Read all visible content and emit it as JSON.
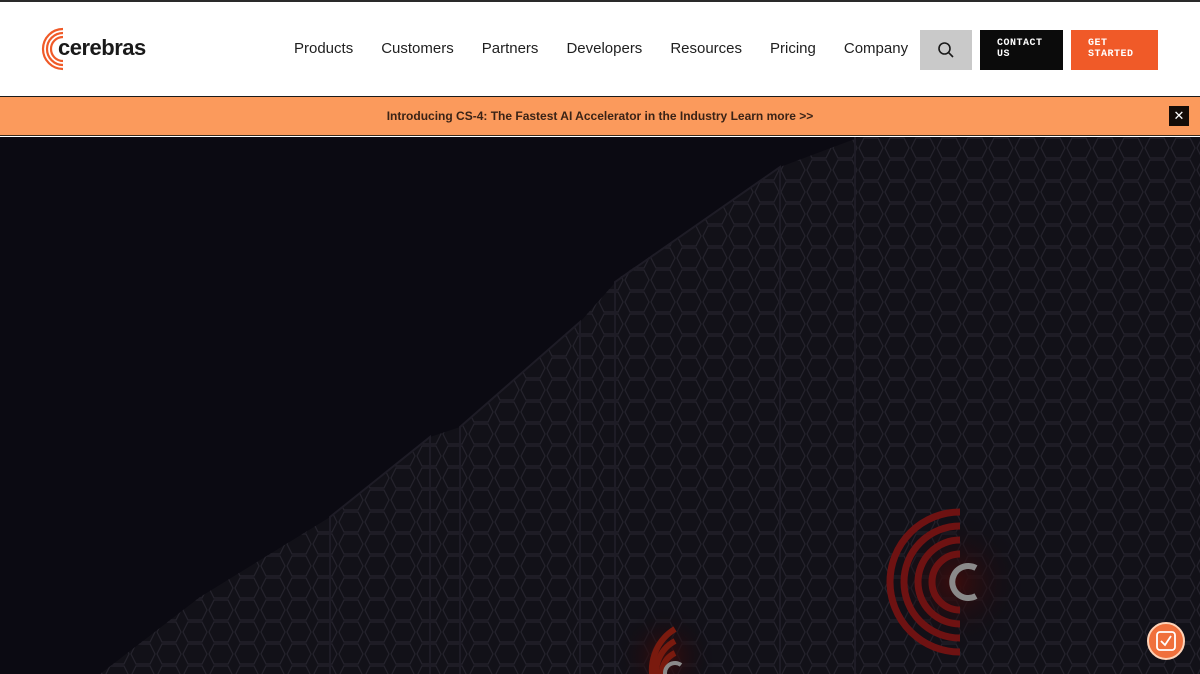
{
  "brand": {
    "name": "cerebras",
    "accent": "#f05a28"
  },
  "nav": {
    "items": [
      {
        "label": "Products"
      },
      {
        "label": "Customers"
      },
      {
        "label": "Partners"
      },
      {
        "label": "Developers"
      },
      {
        "label": "Resources"
      },
      {
        "label": "Pricing"
      },
      {
        "label": "Company"
      }
    ]
  },
  "header": {
    "search_icon": "search-icon",
    "contact_label": "CONTACT US",
    "contact_line1": "CONTACT",
    "contact_line2": "US",
    "started_label": "GET STARTED",
    "started_line1": "GET",
    "started_line2": "STARTED"
  },
  "banner": {
    "text": "Introducing CS-4: The Fastest AI Accelerator in the Industry",
    "link": "Learn more >>",
    "close": "✕",
    "color": "#fb9a5c"
  },
  "hero": {
    "background": "#0b0a12"
  },
  "floating_badge": {
    "icon": "check-badge-icon"
  }
}
